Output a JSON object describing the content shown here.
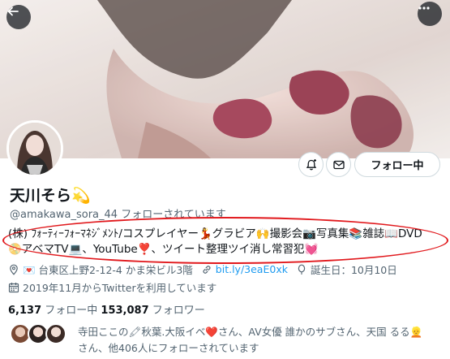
{
  "header": {
    "back_icon": "arrow-left-icon",
    "more_icon": "more-dots-icon"
  },
  "actions": {
    "notify_icon": "bell-plus-icon",
    "message_icon": "mail-icon",
    "follow_label": "フォロー中"
  },
  "profile": {
    "name": "天川そら",
    "name_emoji": "💫",
    "handle": "@amakawa_sora_44",
    "follows_you": "フォローされています",
    "bio_line1": "(株) ﾌｫｰﾃｨｰﾌｫｰﾏﾈｼﾞﾒﾝﾄ/コスプレイヤー💃グラビア🙌撮影会📷写真集📚雑誌📖DVD",
    "bio_line2": "📀アベマTV💻、YouTube❣️、ツイート整理ツイ消し常習犯💓",
    "location": "💌 台東区上野2-12-4 かま栄ビル3階",
    "website": "bit.ly/3eaE0xk",
    "birthday": "誕生日：10月10日",
    "joined": "2019年11月からTwitterを利用しています"
  },
  "stats": {
    "following_count": "6,137",
    "following_label": "フォロー中",
    "followers_count": "153,087",
    "followers_label": "フォロワー"
  },
  "followers_you_know": {
    "text_line1": "寺田ここの🖍秋葉.大阪イベ❤️さん、AV女優 誰かのサブさん、天国 るる👱",
    "text_line2": "さん、他406人にフォローされています"
  },
  "colors": {
    "accent": "#1d9bf0",
    "annotation": "#e1191d",
    "secondary_text": "#536471"
  }
}
